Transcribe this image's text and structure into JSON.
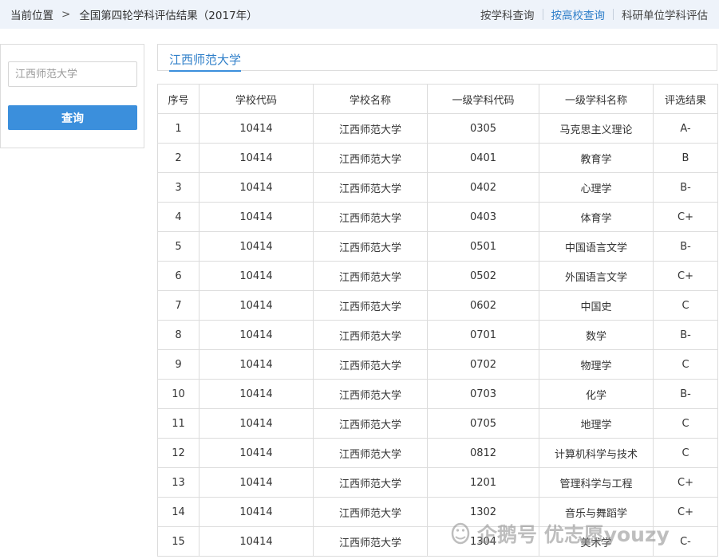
{
  "breadcrumb": {
    "current_label": "当前位置",
    "separator": ">",
    "page": "全国第四轮学科评估结果（2017年）"
  },
  "nav": {
    "by_discipline": "按学科查询",
    "by_school": "按高校查询",
    "by_research_unit": "科研单位学科评估"
  },
  "search": {
    "placeholder": "江西师范大学",
    "button_label": "查询"
  },
  "school_title": "江西师范大学",
  "table": {
    "headers": [
      "序号",
      "学校代码",
      "学校名称",
      "一级学科代码",
      "一级学科名称",
      "评选结果"
    ],
    "rows": [
      [
        "1",
        "10414",
        "江西师范大学",
        "0305",
        "马克思主义理论",
        "A-"
      ],
      [
        "2",
        "10414",
        "江西师范大学",
        "0401",
        "教育学",
        "B"
      ],
      [
        "3",
        "10414",
        "江西师范大学",
        "0402",
        "心理学",
        "B-"
      ],
      [
        "4",
        "10414",
        "江西师范大学",
        "0403",
        "体育学",
        "C+"
      ],
      [
        "5",
        "10414",
        "江西师范大学",
        "0501",
        "中国语言文学",
        "B-"
      ],
      [
        "6",
        "10414",
        "江西师范大学",
        "0502",
        "外国语言文学",
        "C+"
      ],
      [
        "7",
        "10414",
        "江西师范大学",
        "0602",
        "中国史",
        "C"
      ],
      [
        "8",
        "10414",
        "江西师范大学",
        "0701",
        "数学",
        "B-"
      ],
      [
        "9",
        "10414",
        "江西师范大学",
        "0702",
        "物理学",
        "C"
      ],
      [
        "10",
        "10414",
        "江西师范大学",
        "0703",
        "化学",
        "B-"
      ],
      [
        "11",
        "10414",
        "江西师范大学",
        "0705",
        "地理学",
        "C"
      ],
      [
        "12",
        "10414",
        "江西师范大学",
        "0812",
        "计算机科学与技术",
        "C"
      ],
      [
        "13",
        "10414",
        "江西师范大学",
        "1201",
        "管理科学与工程",
        "C+"
      ],
      [
        "14",
        "10414",
        "江西师范大学",
        "1302",
        "音乐与舞蹈学",
        "C+"
      ],
      [
        "15",
        "10414",
        "江西师范大学",
        "1304",
        "美术学",
        "C-"
      ]
    ]
  },
  "watermark": "企鹅号 优志愿youzy",
  "colors": {
    "accent": "#3b8fdc",
    "link_active": "#2f7fc9",
    "topbar_bg": "#eef3fa",
    "border": "#dcdcdc"
  }
}
